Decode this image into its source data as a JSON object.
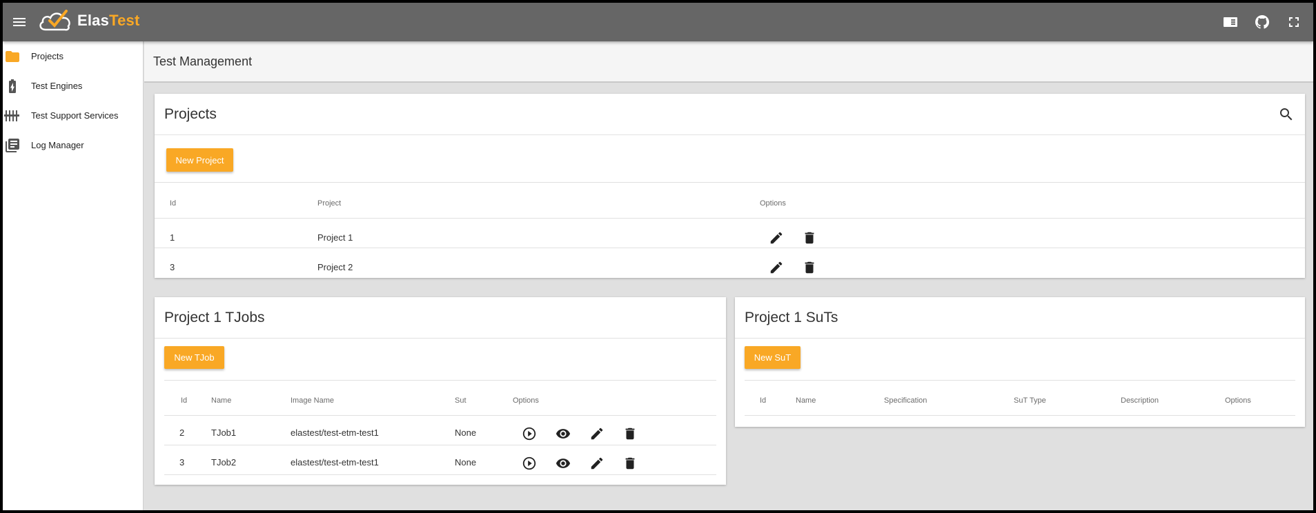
{
  "app": {
    "logo_part1": "Elas",
    "logo_part2": "Test",
    "accent_color": "#f9a825",
    "topbar_color": "#666666"
  },
  "topbar_icons": [
    "menu-icon",
    "dashboard-icon",
    "github-icon",
    "fullscreen-icon"
  ],
  "sidebar": {
    "items": [
      {
        "label": "Projects",
        "icon": "folder-icon"
      },
      {
        "label": "Test Engines",
        "icon": "battery-icon"
      },
      {
        "label": "Test Support Services",
        "icon": "equalizer-icon"
      },
      {
        "label": "Log Manager",
        "icon": "library-books-icon"
      }
    ]
  },
  "page": {
    "title": "Test Management"
  },
  "projects": {
    "title": "Projects",
    "new_button": "New Project",
    "columns": [
      "Id",
      "Project",
      "Options"
    ],
    "rows": [
      {
        "id": "1",
        "name": "Project 1"
      },
      {
        "id": "3",
        "name": "Project 2"
      }
    ]
  },
  "tjobs": {
    "title": "Project 1 TJobs",
    "new_button": "New TJob",
    "columns": [
      "Id",
      "Name",
      "Image Name",
      "Sut",
      "Options"
    ],
    "rows": [
      {
        "id": "2",
        "name": "TJob1",
        "image": "elastest/test-etm-test1",
        "sut": "None"
      },
      {
        "id": "3",
        "name": "TJob2",
        "image": "elastest/test-etm-test1",
        "sut": "None"
      }
    ]
  },
  "suts": {
    "title": "Project 1 SuTs",
    "new_button": "New SuT",
    "columns": [
      "Id",
      "Name",
      "Specification",
      "SuT Type",
      "Description",
      "Options"
    ]
  }
}
